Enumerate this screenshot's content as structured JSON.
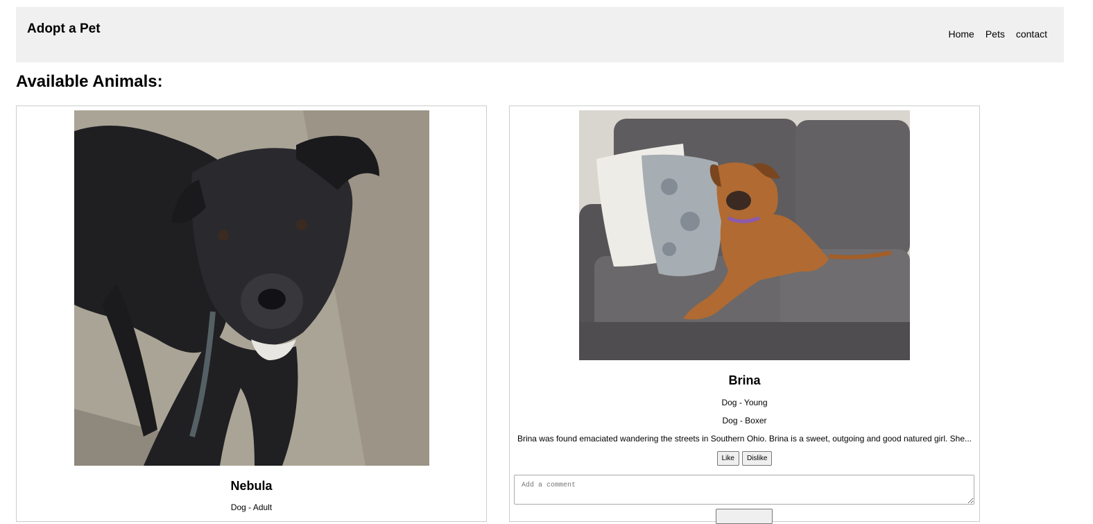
{
  "header": {
    "title": "Adopt a Pet",
    "nav": [
      {
        "label": "Home"
      },
      {
        "label": "Pets"
      },
      {
        "label": "contact"
      }
    ]
  },
  "main": {
    "heading": "Available Animals:",
    "pets": [
      {
        "name": "Nebula",
        "meta1": "Dog - Adult",
        "photo": "black-dog-photo"
      },
      {
        "name": "Brina",
        "meta1": "Dog - Young",
        "meta2": "Dog - Boxer",
        "description": "Brina was found emaciated wandering the streets in Southern Ohio. Brina is a sweet, outgoing and good natured girl. She...",
        "like_label": "Like",
        "dislike_label": "Dislike",
        "comment_placeholder": "Add a comment",
        "photo": "brown-dog-on-couch-photo"
      }
    ]
  },
  "colors": {
    "header_bg": "#f0f0f0",
    "card_border": "#cccccc"
  }
}
